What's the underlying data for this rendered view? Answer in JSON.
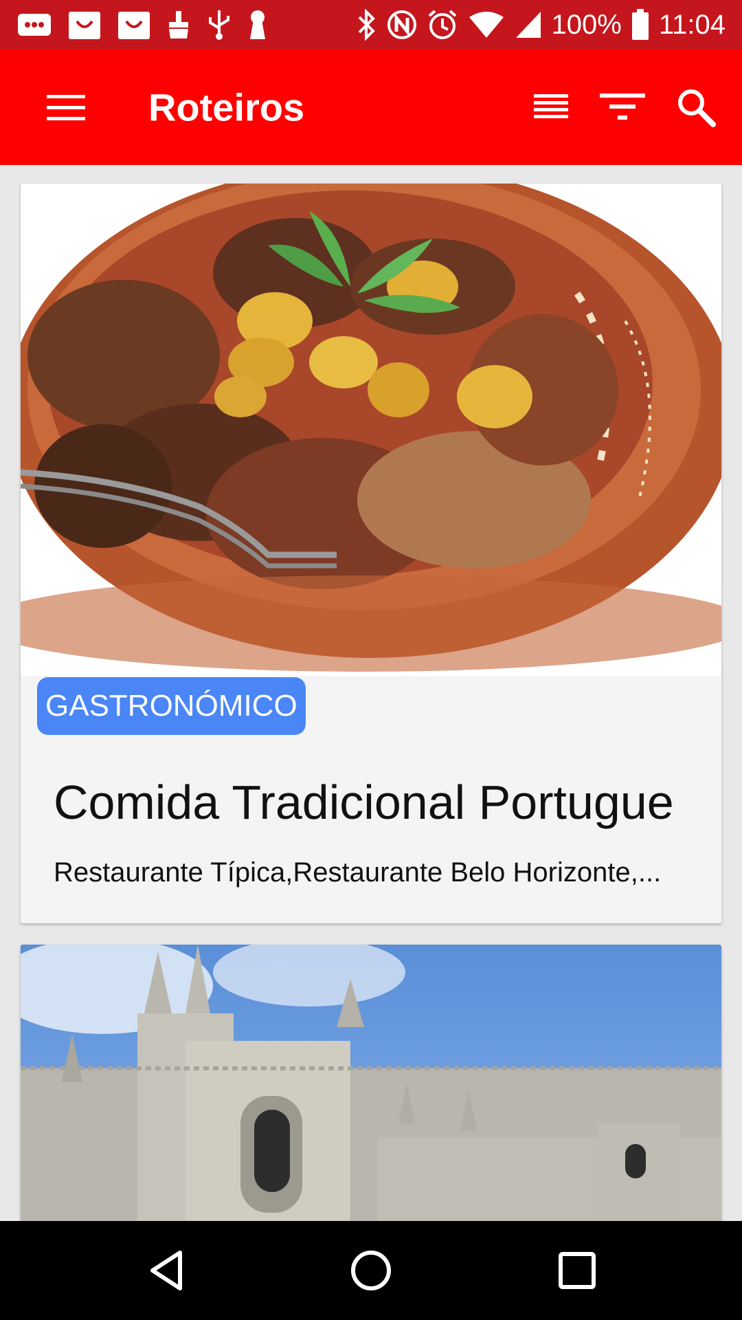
{
  "status_bar": {
    "battery_text": "100%",
    "time": "11:04",
    "icons": [
      "messages-icon",
      "bag-icon",
      "bag-icon",
      "cleaner-icon",
      "usb-icon",
      "keyhole-icon",
      "bluetooth-icon",
      "nfc-icon",
      "alarm-icon",
      "wifi-icon",
      "signal-icon",
      "battery-icon"
    ]
  },
  "app_bar": {
    "title": "Roteiros",
    "icons": [
      "menu-icon",
      "list-view-icon",
      "filter-icon",
      "search-icon"
    ]
  },
  "cards": [
    {
      "category": "GASTRONÓMICO",
      "title": "Comida Tradicional Portugue",
      "subtitle": "Restaurante Típica,Restaurante Belo Horizonte,..."
    }
  ],
  "colors": {
    "status_bar": "#c4161c",
    "app_bar": "#ff0000",
    "chip": "#4a86f5",
    "card_bg": "#f4f4f4"
  },
  "nav_bar": {
    "icons": [
      "back-icon",
      "home-icon",
      "recent-apps-icon"
    ]
  }
}
